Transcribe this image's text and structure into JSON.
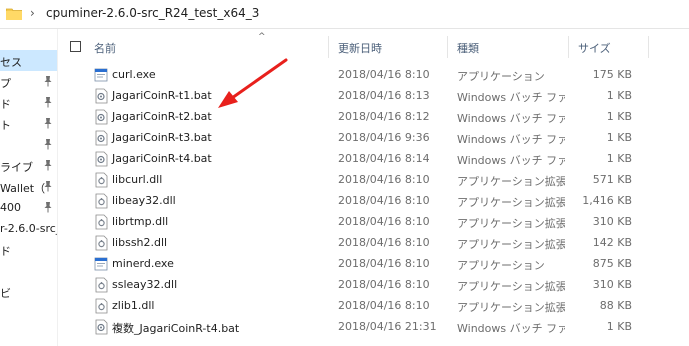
{
  "address": {
    "path": "cpuminer-2.6.0-src_R24_test_x64_3"
  },
  "nav": {
    "items": [
      {
        "label": "セス",
        "pinned": false,
        "selected": true
      },
      {
        "label": "プ",
        "pinned": true,
        "selected": false
      },
      {
        "label": "ド",
        "pinned": true,
        "selected": false
      },
      {
        "label": "ト",
        "pinned": true,
        "selected": false
      },
      {
        "label": "",
        "pinned": true,
        "selected": false
      },
      {
        "label": "ライブ",
        "pinned": true,
        "selected": false
      },
      {
        "label": "Wallet（",
        "pinned": true,
        "selected": false
      },
      {
        "label": "400",
        "pinned": true,
        "selected": false
      },
      {
        "label": "r-2.6.0-src_",
        "pinned": false,
        "selected": false
      },
      {
        "label": "ド",
        "pinned": false,
        "selected": false
      },
      {
        "label": "",
        "pinned": false,
        "selected": false
      },
      {
        "label": "ビ",
        "pinned": false,
        "selected": false
      }
    ]
  },
  "columns": {
    "name": "名前",
    "date": "更新日時",
    "type": "種類",
    "size": "サイズ",
    "sort_indicator": "^"
  },
  "files": [
    {
      "name": "curl.exe",
      "date": "2018/04/16 8:10",
      "type": "アプリケーション",
      "size": "175 KB",
      "icon": "exe-icon"
    },
    {
      "name": "JagariCoinR-t1.bat",
      "date": "2018/04/16 8:13",
      "type": "Windows バッチ ファ...",
      "size": "1 KB",
      "icon": "bat-icon"
    },
    {
      "name": "JagariCoinR-t2.bat",
      "date": "2018/04/16 8:12",
      "type": "Windows バッチ ファ...",
      "size": "1 KB",
      "icon": "bat-icon"
    },
    {
      "name": "JagariCoinR-t3.bat",
      "date": "2018/04/16 9:36",
      "type": "Windows バッチ ファ...",
      "size": "1 KB",
      "icon": "bat-icon"
    },
    {
      "name": "JagariCoinR-t4.bat",
      "date": "2018/04/16 8:14",
      "type": "Windows バッチ ファ...",
      "size": "1 KB",
      "icon": "bat-icon"
    },
    {
      "name": "libcurl.dll",
      "date": "2018/04/16 8:10",
      "type": "アプリケーション拡張",
      "size": "571 KB",
      "icon": "dll-icon"
    },
    {
      "name": "libeay32.dll",
      "date": "2018/04/16 8:10",
      "type": "アプリケーション拡張",
      "size": "1,416 KB",
      "icon": "dll-icon"
    },
    {
      "name": "librtmp.dll",
      "date": "2018/04/16 8:10",
      "type": "アプリケーション拡張",
      "size": "310 KB",
      "icon": "dll-icon"
    },
    {
      "name": "libssh2.dll",
      "date": "2018/04/16 8:10",
      "type": "アプリケーション拡張",
      "size": "142 KB",
      "icon": "dll-icon"
    },
    {
      "name": "minerd.exe",
      "date": "2018/04/16 8:10",
      "type": "アプリケーション",
      "size": "875 KB",
      "icon": "exe-icon"
    },
    {
      "name": "ssleay32.dll",
      "date": "2018/04/16 8:10",
      "type": "アプリケーション拡張",
      "size": "310 KB",
      "icon": "dll-icon"
    },
    {
      "name": "zlib1.dll",
      "date": "2018/04/16 8:10",
      "type": "アプリケーション拡張",
      "size": "88 KB",
      "icon": "dll-icon"
    },
    {
      "name": "複数_JagariCoinR-t4.bat",
      "date": "2018/04/16 21:31",
      "type": "Windows バッチ ファ...",
      "size": "1 KB",
      "icon": "bat-icon"
    }
  ],
  "colors": {
    "selection": "#cce8ff",
    "arrow": "#e8201c",
    "header_text": "#4c607a"
  }
}
